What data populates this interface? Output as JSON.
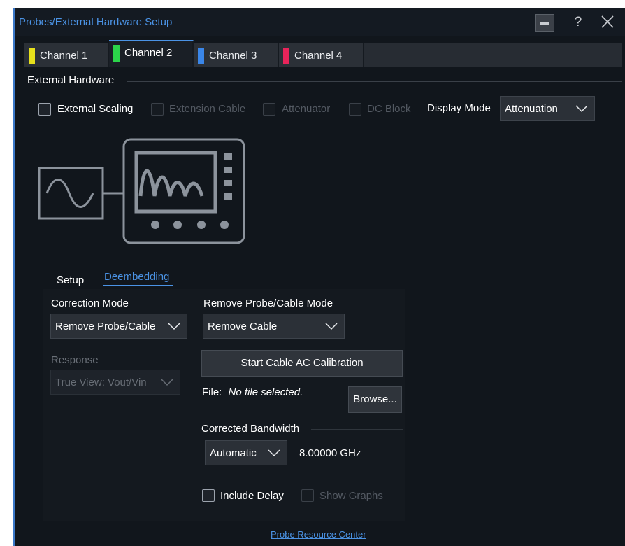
{
  "window": {
    "title": "Probes/External Hardware Setup",
    "help_label": "?"
  },
  "tabs": [
    {
      "label": "Channel 1",
      "color": "#e6e01c",
      "active": false
    },
    {
      "label": "Channel 2",
      "color": "#2bd44a",
      "active": true
    },
    {
      "label": "Channel 3",
      "color": "#3a86e8",
      "active": false
    },
    {
      "label": "Channel 4",
      "color": "#e8245a",
      "active": false
    }
  ],
  "external_hardware": {
    "section_title": "External Hardware",
    "external_scaling": {
      "label": "External Scaling",
      "checked": false,
      "enabled": true
    },
    "extension_cable": {
      "label": "Extension Cable",
      "checked": false,
      "enabled": false
    },
    "attenuator": {
      "label": "Attenuator",
      "checked": false,
      "enabled": false
    },
    "dc_block": {
      "label": "DC Block",
      "checked": false,
      "enabled": false
    },
    "display_mode": {
      "label": "Display Mode",
      "value": "Attenuation"
    }
  },
  "subtabs": {
    "setup": "Setup",
    "deembedding": "Deembedding",
    "active": "deembedding"
  },
  "deembedding": {
    "correction_mode": {
      "label": "Correction Mode",
      "value": "Remove Probe/Cable"
    },
    "response": {
      "label": "Response",
      "value": "True View: Vout/Vin",
      "enabled": false
    },
    "remove_mode": {
      "label": "Remove Probe/Cable Mode",
      "value": "Remove Cable"
    },
    "calibration_button": "Start Cable AC Calibration",
    "file": {
      "label": "File:",
      "value": "No file selected.",
      "browse_label": "Browse..."
    },
    "corrected_bandwidth": {
      "label": "Corrected Bandwidth",
      "mode": "Automatic",
      "value": "8.00000 GHz"
    },
    "include_delay": {
      "label": "Include Delay",
      "checked": false,
      "enabled": true
    },
    "show_graphs": {
      "label": "Show Graphs",
      "checked": false,
      "enabled": false
    }
  },
  "footer": {
    "link": "Probe Resource Center"
  },
  "colors": {
    "accent": "#4b93e5",
    "background": "#11161c"
  },
  "icons": [
    "minimize-icon",
    "help-icon",
    "close-icon",
    "chevron-down-icon",
    "sine-source-icon",
    "oscilloscope-icon"
  ]
}
